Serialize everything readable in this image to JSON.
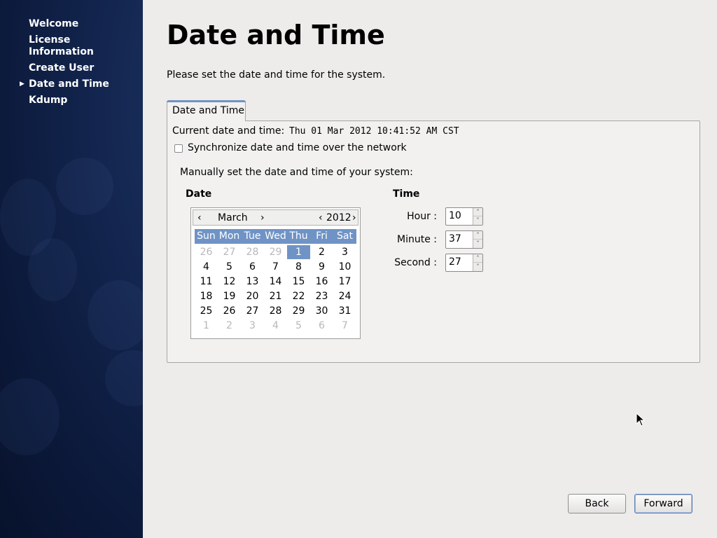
{
  "sidebar": {
    "items": [
      {
        "label": "Welcome",
        "current": false
      },
      {
        "label": "License Information",
        "current": false
      },
      {
        "label": "Create User",
        "current": false
      },
      {
        "label": "Date and Time",
        "current": true
      },
      {
        "label": "Kdump",
        "current": false
      }
    ]
  },
  "main": {
    "title": "Date and Time",
    "subtitle": "Please set the date and time for the system.",
    "tab_label": "Date and Time",
    "current_label": "Current date and time:",
    "current_value": "Thu 01 Mar 2012 10:41:52 AM CST",
    "sync_label": "Synchronize date and time over the network",
    "sync_checked": false,
    "manual_label": "Manually set the date and time of your system:",
    "date_heading": "Date",
    "time_heading": "Time"
  },
  "calendar": {
    "month": "March",
    "year": "2012",
    "prev_month": "‹",
    "next_month": "›",
    "prev_year": "‹",
    "next_year": "›",
    "weekdays": [
      "Sun",
      "Mon",
      "Tue",
      "Wed",
      "Thu",
      "Fri",
      "Sat"
    ],
    "selected_day": 1,
    "weeks": [
      [
        {
          "d": "26",
          "o": true
        },
        {
          "d": "27",
          "o": true
        },
        {
          "d": "28",
          "o": true
        },
        {
          "d": "29",
          "o": true
        },
        {
          "d": "1",
          "o": false
        },
        {
          "d": "2",
          "o": false
        },
        {
          "d": "3",
          "o": false
        }
      ],
      [
        {
          "d": "4",
          "o": false
        },
        {
          "d": "5",
          "o": false
        },
        {
          "d": "6",
          "o": false
        },
        {
          "d": "7",
          "o": false
        },
        {
          "d": "8",
          "o": false
        },
        {
          "d": "9",
          "o": false
        },
        {
          "d": "10",
          "o": false
        }
      ],
      [
        {
          "d": "11",
          "o": false
        },
        {
          "d": "12",
          "o": false
        },
        {
          "d": "13",
          "o": false
        },
        {
          "d": "14",
          "o": false
        },
        {
          "d": "15",
          "o": false
        },
        {
          "d": "16",
          "o": false
        },
        {
          "d": "17",
          "o": false
        }
      ],
      [
        {
          "d": "18",
          "o": false
        },
        {
          "d": "19",
          "o": false
        },
        {
          "d": "20",
          "o": false
        },
        {
          "d": "21",
          "o": false
        },
        {
          "d": "22",
          "o": false
        },
        {
          "d": "23",
          "o": false
        },
        {
          "d": "24",
          "o": false
        }
      ],
      [
        {
          "d": "25",
          "o": false
        },
        {
          "d": "26",
          "o": false
        },
        {
          "d": "27",
          "o": false
        },
        {
          "d": "28",
          "o": false
        },
        {
          "d": "29",
          "o": false
        },
        {
          "d": "30",
          "o": false
        },
        {
          "d": "31",
          "o": false
        }
      ],
      [
        {
          "d": "1",
          "o": true
        },
        {
          "d": "2",
          "o": true
        },
        {
          "d": "3",
          "o": true
        },
        {
          "d": "4",
          "o": true
        },
        {
          "d": "5",
          "o": true
        },
        {
          "d": "6",
          "o": true
        },
        {
          "d": "7",
          "o": true
        }
      ]
    ]
  },
  "time": {
    "hour_label": "Hour :",
    "hour_value": "10",
    "minute_label": "Minute :",
    "minute_value": "37",
    "second_label": "Second :",
    "second_value": "27",
    "up_glyph": "˄",
    "down_glyph": "˅"
  },
  "buttons": {
    "back": "Back",
    "forward": "Forward"
  },
  "colors": {
    "accent": "#6f93c5",
    "sidebar_bg": "#0c1a3c"
  },
  "icons": {
    "current_item_marker": "arrow-right-icon",
    "cursor": "mouse-pointer-icon"
  }
}
